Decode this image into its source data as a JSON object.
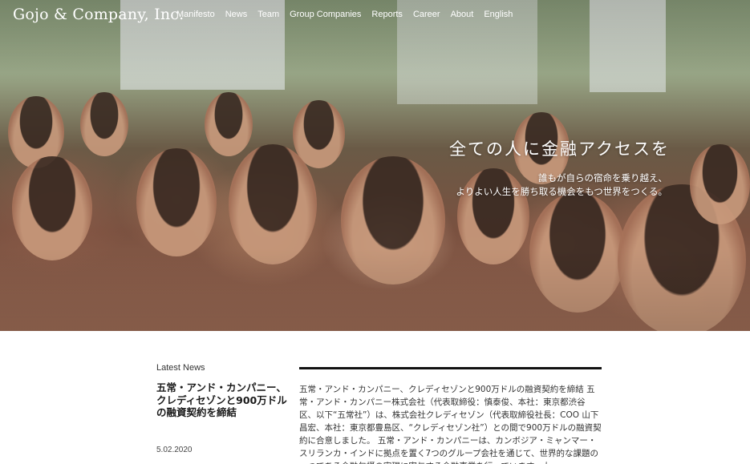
{
  "header": {
    "logo": "Gojo & Company, Inc.",
    "nav": [
      "Manifesto",
      "News",
      "Team",
      "Group Companies",
      "Reports",
      "Career",
      "About",
      "English"
    ]
  },
  "hero": {
    "tagline": "全ての人に金融アクセスを",
    "subline_1": "誰もが自らの宿命を乗り越え、",
    "subline_2": "よりよい人生を勝ち取る機会をもつ世界をつくる。"
  },
  "news": {
    "label": "Latest News",
    "title": "五常・アンド・カンパニー、クレディセゾンと900万ドルの融資契約を締結",
    "date": "5.02.2020",
    "body": "五常・アンド・カンパニー、クレディセゾンと900万ドルの融資契約を締結 五常・アンド・カンパニー株式会社（代表取締役：慎泰俊、本社：東京都渋谷区、以下“五常社”）は、株式会社クレディセゾン（代表取締役社長：COO 山下昌宏、本社：東京都豊島区、“クレディセゾン社”）との間で900万ドルの融資契約に合意しました。 五常・アンド・カンパニーは、カンボジア・ミャンマー・スリランカ・インドに拠点を置く7つのグループ会社を通じて、世界的な課題の一つである金融包摂の実現に寄与する金融事業を行っています。大"
  }
}
